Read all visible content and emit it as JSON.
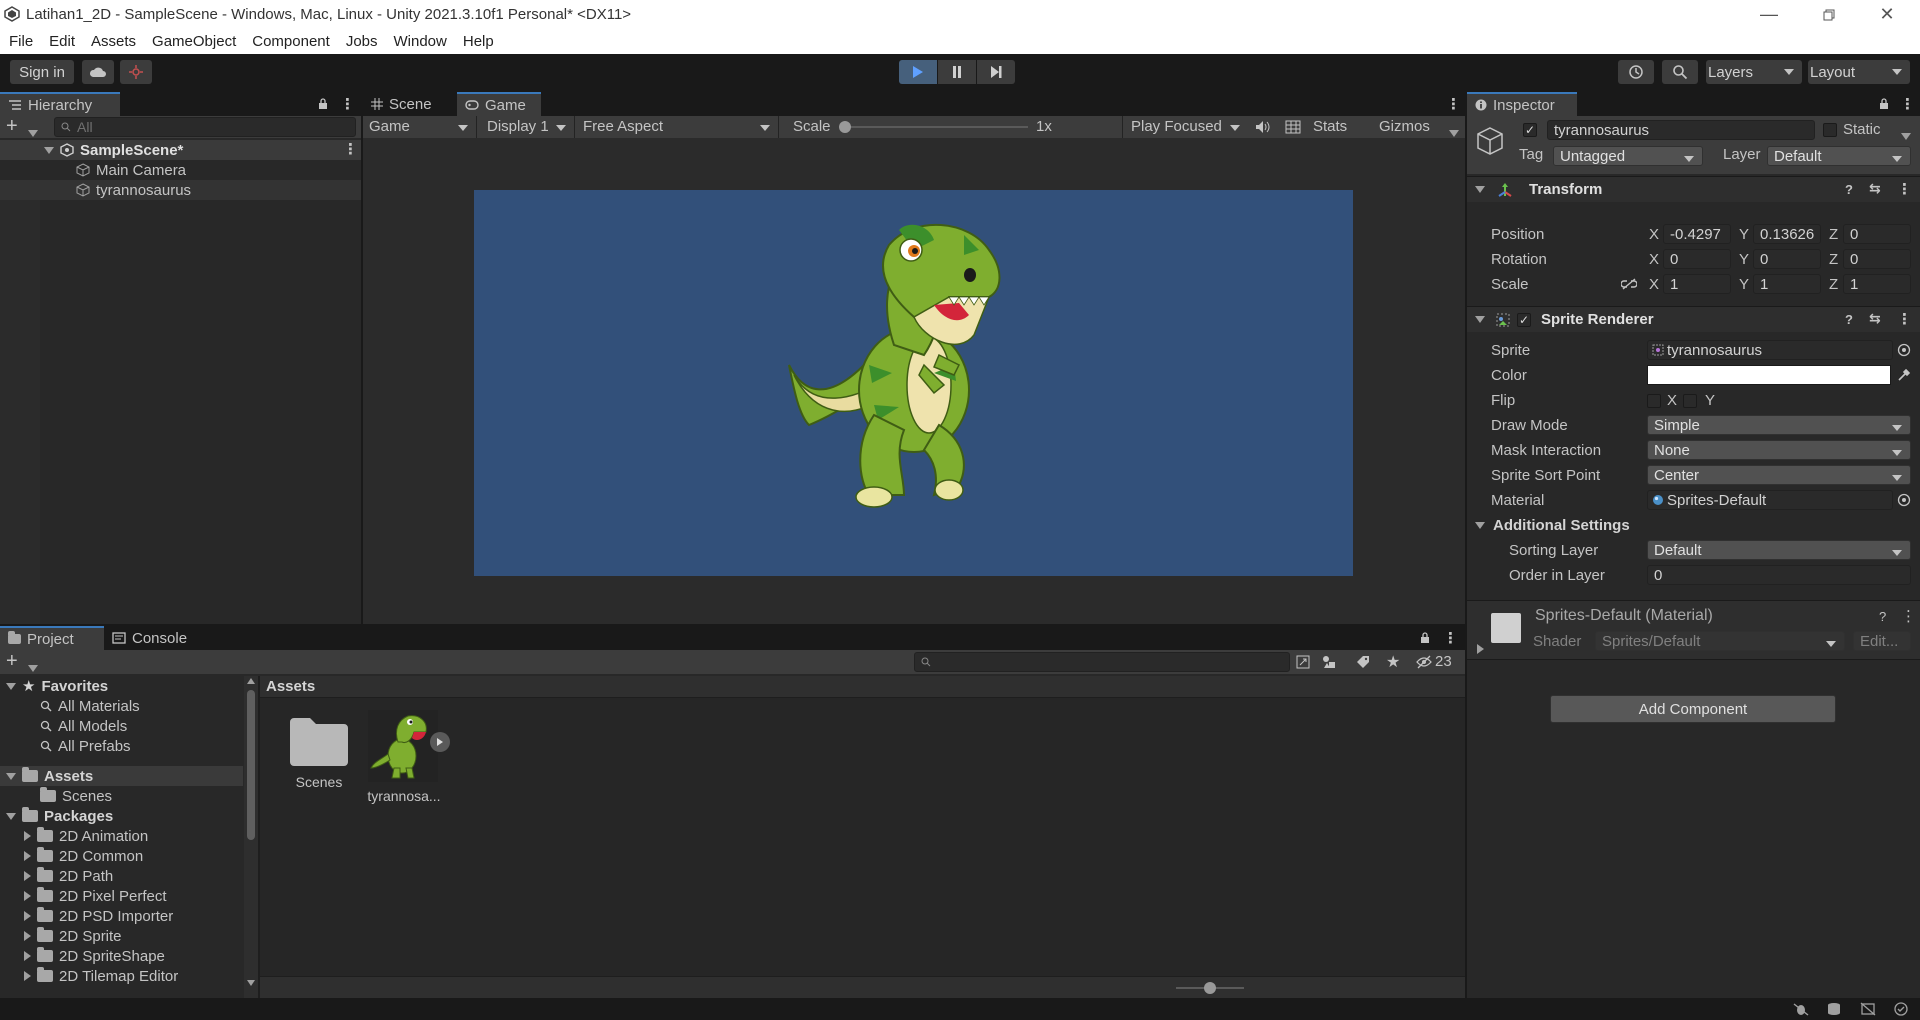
{
  "window": {
    "title": "Latihan1_2D - SampleScene - Windows, Mac, Linux - Unity 2021.3.10f1 Personal* <DX11>"
  },
  "menu": [
    "File",
    "Edit",
    "Assets",
    "GameObject",
    "Component",
    "Jobs",
    "Window",
    "Help"
  ],
  "toolbar": {
    "sign_in": "Sign in",
    "layers": "Layers",
    "layout": "Layout"
  },
  "hierarchy": {
    "tab": "Hierarchy",
    "search_placeholder": "All",
    "scene": "SampleScene*",
    "objects": [
      "Main Camera",
      "tyrannosaurus"
    ]
  },
  "game_view": {
    "tabs": [
      "Scene",
      "Game"
    ],
    "mode": "Game",
    "display": "Display 1",
    "aspect": "Free Aspect",
    "scale_label": "Scale",
    "scale_value": "1x",
    "play_focus": "Play Focused",
    "stats": "Stats",
    "gizmos": "Gizmos",
    "background_color": "#32507a"
  },
  "inspector": {
    "tab": "Inspector",
    "object_name": "tyrannosaurus",
    "static_label": "Static",
    "tag_label": "Tag",
    "tag_value": "Untagged",
    "layer_label": "Layer",
    "layer_value": "Default",
    "transform": {
      "title": "Transform",
      "rows": [
        {
          "label": "Position",
          "x": "-0.4297",
          "y": "0.13626",
          "z": "0"
        },
        {
          "label": "Rotation",
          "x": "0",
          "y": "0",
          "z": "0"
        },
        {
          "label": "Scale",
          "x": "1",
          "y": "1",
          "z": "1"
        }
      ]
    },
    "sprite_renderer": {
      "title": "Sprite Renderer",
      "sprite_label": "Sprite",
      "sprite_value": "tyrannosaurus",
      "color_label": "Color",
      "color_value": "#ffffff",
      "flip_label": "Flip",
      "flip_x": "X",
      "flip_y": "Y",
      "draw_mode_label": "Draw Mode",
      "draw_mode_value": "Simple",
      "mask_label": "Mask Interaction",
      "mask_value": "None",
      "sort_point_label": "Sprite Sort Point",
      "sort_point_value": "Center",
      "material_label": "Material",
      "material_value": "Sprites-Default",
      "additional_label": "Additional Settings",
      "sorting_layer_label": "Sorting Layer",
      "sorting_layer_value": "Default",
      "order_label": "Order in Layer",
      "order_value": "0"
    },
    "material": {
      "title": "Sprites-Default (Material)",
      "shader_label": "Shader",
      "shader_value": "Sprites/Default",
      "edit_label": "Edit..."
    },
    "add_component": "Add Component"
  },
  "project": {
    "tabs": [
      "Project",
      "Console"
    ],
    "hidden_count": "23",
    "favorites_label": "Favorites",
    "favorites": [
      "All Materials",
      "All Models",
      "All Prefabs"
    ],
    "assets_label": "Assets",
    "assets_children": [
      "Scenes"
    ],
    "packages_label": "Packages",
    "packages": [
      "2D Animation",
      "2D Common",
      "2D Path",
      "2D Pixel Perfect",
      "2D PSD Importer",
      "2D Sprite",
      "2D SpriteShape",
      "2D Tilemap Editor"
    ],
    "breadcrumb": "Assets",
    "items": [
      "Scenes",
      "tyrannosa..."
    ]
  }
}
